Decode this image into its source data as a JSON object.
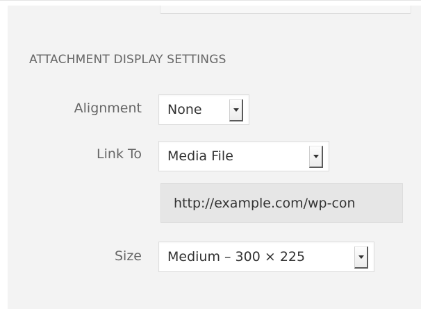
{
  "section_title": "ATTACHMENT DISPLAY SETTINGS",
  "alignment": {
    "label": "Alignment",
    "value": "None"
  },
  "link_to": {
    "label": "Link To",
    "value": "Media File",
    "url": "http://example.com/wp-con"
  },
  "size": {
    "label": "Size",
    "value": "Medium – 300 × 225"
  },
  "icons": {
    "dropdown": "chevron-down-icon"
  },
  "colors": {
    "panel_background": "#f3f3f3",
    "label_text": "#666666",
    "value_text": "#333333",
    "url_field_background": "#e6e6e6"
  }
}
